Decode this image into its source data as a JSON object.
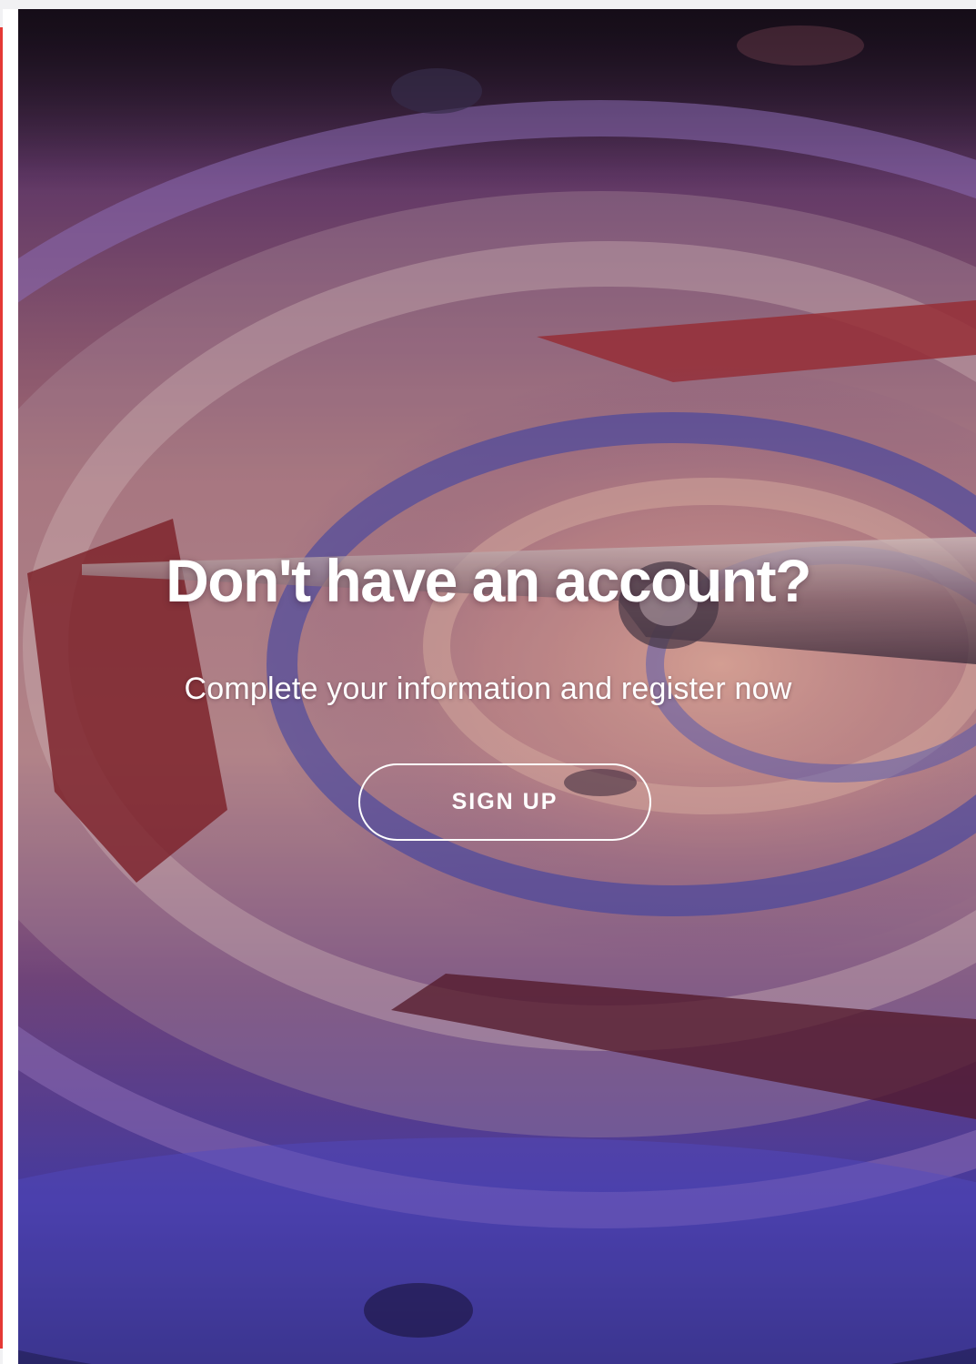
{
  "promo": {
    "headline": "Don't have an account?",
    "subtitle": "Complete your information and register now",
    "signup_label": "SIGN UP"
  },
  "colors": {
    "accent_strip": "#e53935",
    "text": "#ffffff"
  }
}
